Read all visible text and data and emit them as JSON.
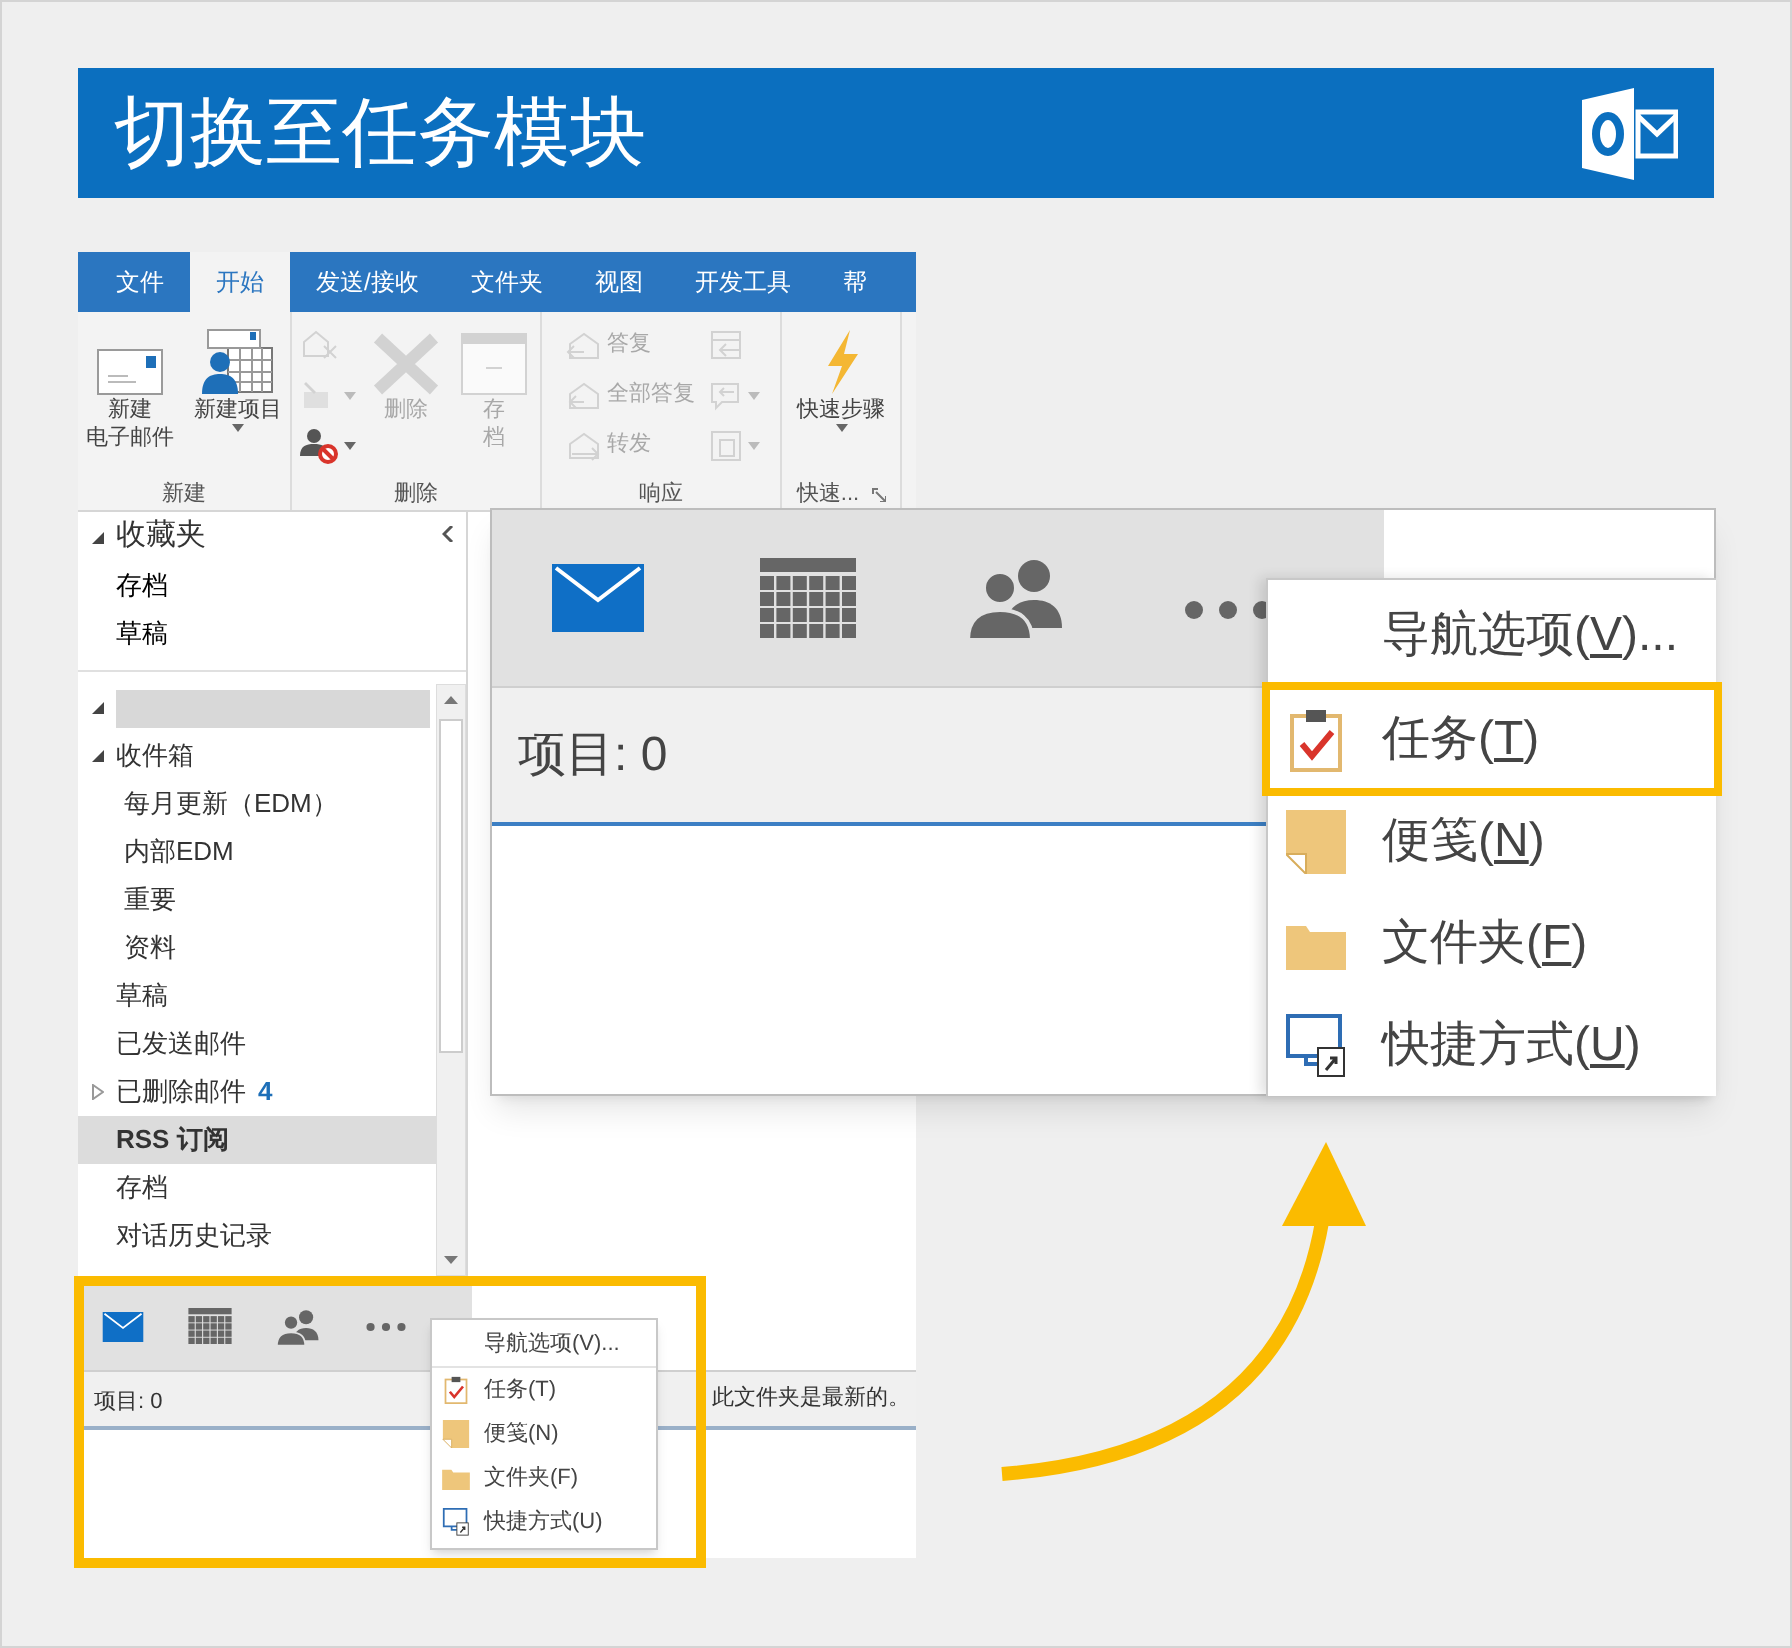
{
  "header": {
    "title": "切换至任务模块"
  },
  "outlook": {
    "ribbon_tabs": [
      {
        "label": "文件",
        "selected": false
      },
      {
        "label": "开始",
        "selected": true
      },
      {
        "label": "发送/接收",
        "selected": false
      },
      {
        "label": "文件夹",
        "selected": false
      },
      {
        "label": "视图",
        "selected": false
      },
      {
        "label": "开发工具",
        "selected": false
      },
      {
        "label": "帮",
        "selected": false
      }
    ],
    "ribbon_groups": [
      {
        "label": "新建",
        "launcher": false,
        "commands": [
          {
            "kind": "new-email",
            "lines": [
              "新建",
              "电子邮件"
            ],
            "disabled": false,
            "dropdown": false
          },
          {
            "kind": "new-items",
            "lines": [
              "新建项目"
            ],
            "disabled": false,
            "dropdown": true
          }
        ]
      },
      {
        "label": "删除",
        "launcher": false,
        "commands": [
          {
            "kind": "column",
            "items": [
              {
                "kind": "ignore",
                "disabled": true,
                "dropdown": false
              },
              {
                "kind": "cleanup",
                "disabled": true,
                "dropdown": true
              },
              {
                "kind": "junk",
                "disabled": false,
                "dropdown": true
              }
            ]
          },
          {
            "kind": "delete",
            "lines": [
              "删除"
            ],
            "disabled": true,
            "dropdown": false
          },
          {
            "kind": "archive",
            "lines": [
              "存",
              "档"
            ],
            "disabled": true,
            "dropdown": false
          }
        ]
      },
      {
        "label": "响应",
        "launcher": false,
        "commands": [
          {
            "kind": "column",
            "items": [
              {
                "kind": "reply",
                "label": "答复",
                "disabled": true,
                "dropdown": false
              },
              {
                "kind": "reply-all",
                "label": "全部答复",
                "disabled": true,
                "dropdown": false
              },
              {
                "kind": "forward",
                "label": "转发",
                "disabled": true,
                "dropdown": false
              }
            ]
          },
          {
            "kind": "column",
            "items": [
              {
                "kind": "meeting",
                "disabled": true,
                "dropdown": false
              },
              {
                "kind": "im",
                "disabled": true,
                "dropdown": true
              },
              {
                "kind": "more",
                "disabled": true,
                "dropdown": true
              }
            ]
          }
        ]
      },
      {
        "label": "快速...",
        "launcher": true,
        "commands": [
          {
            "kind": "quick-steps",
            "lines": [
              "快速步骤"
            ],
            "disabled": false,
            "dropdown": true
          }
        ]
      }
    ],
    "favorites": {
      "label": "收藏夹",
      "expanded": true,
      "items": [
        {
          "label": "存档",
          "selected": false
        },
        {
          "label": "草稿",
          "selected": false
        }
      ]
    },
    "folders": [
      {
        "redacted": true,
        "expanded": true,
        "selected": false,
        "children": [
          {
            "label": "收件箱",
            "expanded": true,
            "selected": false,
            "children": [
              {
                "label": "每月更新（EDM）",
                "selected": false
              },
              {
                "label": "内部EDM",
                "selected": false
              },
              {
                "label": "重要",
                "selected": false
              },
              {
                "label": "资料",
                "selected": false
              }
            ]
          },
          {
            "label": "草稿",
            "selected": false
          },
          {
            "label": "已发送邮件",
            "selected": false
          },
          {
            "label": "已删除邮件",
            "count": "4",
            "expanded": false,
            "selected": false
          },
          {
            "label": "RSS 订阅",
            "selected": true
          },
          {
            "label": "存档",
            "selected": false
          },
          {
            "label": "对话历史记录",
            "selected": false
          }
        ]
      }
    ],
    "navigation": [
      {
        "kind": "mail",
        "selected": true
      },
      {
        "kind": "calendar",
        "selected": false
      },
      {
        "kind": "people",
        "selected": false
      },
      {
        "kind": "more",
        "selected": false
      }
    ],
    "status": {
      "items_count": "项目: 0",
      "sync_status": "此文件夹是最新的。"
    },
    "menu": [
      {
        "kind": "nav-options",
        "label": "导航选项(V)..."
      },
      {
        "kind": "tasks",
        "label": "任务(T)"
      },
      {
        "kind": "notes",
        "label": "便笺(N)"
      },
      {
        "kind": "folders",
        "label": "文件夹(F)"
      },
      {
        "kind": "shortcuts",
        "label": "快捷方式(U)"
      }
    ]
  },
  "zoom_view": {
    "navigation": [
      {
        "kind": "mail",
        "selected": true
      },
      {
        "kind": "calendar",
        "selected": false
      },
      {
        "kind": "people",
        "selected": false
      },
      {
        "kind": "more",
        "selected": false
      }
    ],
    "items_count": "项目: 0",
    "menu": [
      {
        "kind": "nav-options",
        "label_before": "导航选项(",
        "access_key": "V",
        "label_after": ")...",
        "highlighted": false
      },
      {
        "kind": "tasks",
        "label_before": "任务(",
        "access_key": "T",
        "label_after": ")",
        "highlighted": true
      },
      {
        "kind": "notes",
        "label_before": "便笺(",
        "access_key": "N",
        "label_after": ")",
        "highlighted": false
      },
      {
        "kind": "folders",
        "label_before": "文件夹(",
        "access_key": "F",
        "label_after": ")",
        "highlighted": false
      },
      {
        "kind": "shortcuts",
        "label_before": "快捷方式(",
        "access_key": "U",
        "label_after": ")",
        "highlighted": false
      }
    ]
  }
}
